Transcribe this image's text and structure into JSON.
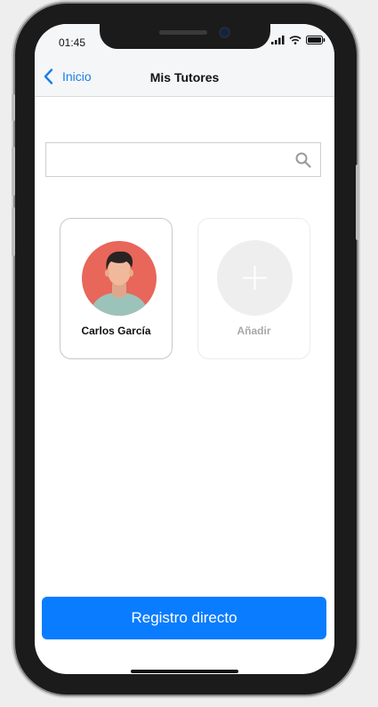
{
  "status_bar": {
    "time": "01:45"
  },
  "nav": {
    "back_label": "Inicio",
    "title": "Mis Tutores"
  },
  "search": {
    "placeholder": "",
    "value": ""
  },
  "tutors": [
    {
      "name": "Carlos García"
    }
  ],
  "add_card": {
    "label": "Añadir"
  },
  "cta": {
    "label": "Registro directo"
  },
  "colors": {
    "accent": "#0a7cff",
    "link": "#1a7fe6",
    "avatar_bg": "#e8665a"
  },
  "icons": [
    "chevron-left-icon",
    "search-icon",
    "plus-icon",
    "signal-icon",
    "wifi-icon",
    "battery-icon"
  ]
}
